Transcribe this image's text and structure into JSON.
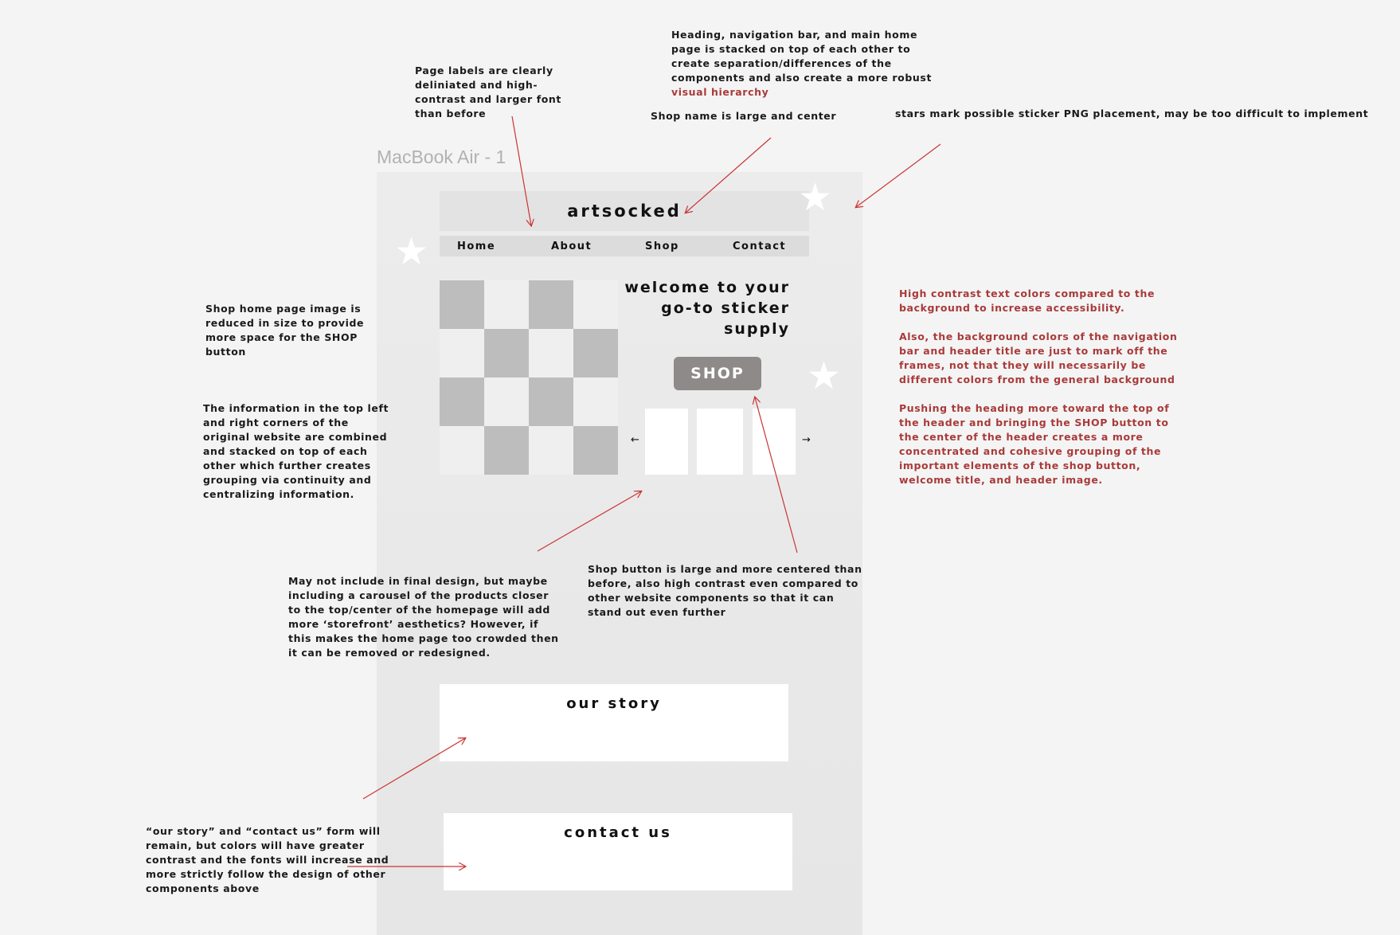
{
  "frame_label": "MacBook Air - 1",
  "site": {
    "title": "artsocked",
    "nav": [
      "Home",
      "About",
      "Shop",
      "Contact"
    ],
    "welcome_lines": [
      "welcome to your",
      "go-to sticker",
      "supply"
    ],
    "shop_button": "SHOP",
    "carousel_prev": "←",
    "carousel_next": "→",
    "our_story": "our story",
    "contact_us": "contact us"
  },
  "annotations": {
    "page_labels": [
      "Page labels are clearly",
      "deliniated and high-",
      "contrast and larger font",
      "than before"
    ],
    "stacking": [
      "Heading, navigation bar, and main home",
      "page is stacked on top of each other to",
      "create separation/differences of the",
      "components and also create a more robust"
    ],
    "stacking_highlight": "visual hierarchy",
    "shop_name": "Shop name is large and center",
    "stars": "stars mark possible sticker PNG placement, may be too difficult to implement",
    "image_reduced": [
      "Shop home page image is",
      "reduced in size to provide",
      "more space for the SHOP",
      "button"
    ],
    "info_combined": [
      "The information in the top left",
      "and right corners of the",
      "original website are combined",
      "and stacked on top of each",
      "other which further creates",
      "grouping via continuity and",
      "centralizing information."
    ],
    "carousel": [
      "May not include in final design, but maybe",
      "including a carousel of the products closer",
      "to the top/center of the homepage will add",
      "more ‘storefront’ aesthetics? However, if",
      "this makes the home page too crowded then",
      "it can be removed or redesigned."
    ],
    "shop_button": [
      "Shop button is large and more centered than",
      "before, also high contrast even compared to",
      "other website components so that it can",
      "stand out even further"
    ],
    "story_contact": [
      "“our story” and “contact us” form will",
      "remain, but colors will have greater",
      "contrast and the fonts will increase and",
      "more strictly follow the design of other",
      "components above"
    ],
    "contrast": [
      "High contrast text colors compared to the",
      "background to increase accessibility."
    ],
    "bg_colors": [
      "Also, the background colors of the navigation",
      "bar and header title are just to mark off the",
      "frames, not that they will necessarily be",
      "different colors from the general background"
    ],
    "pushing": [
      "Pushing the heading more toward the top of",
      "the header and bringing the SHOP button to",
      "the center of the header creates a more",
      "concentrated and cohesive grouping of the",
      "important elements of the shop button,",
      "welcome title, and header image."
    ]
  },
  "colors": {
    "arrow": "#cc3333",
    "annotation_red": "#a93a3a",
    "shop_button": "#8f8a8a"
  },
  "icons": [
    "star-icon",
    "arrow-left-icon",
    "arrow-right-icon"
  ]
}
